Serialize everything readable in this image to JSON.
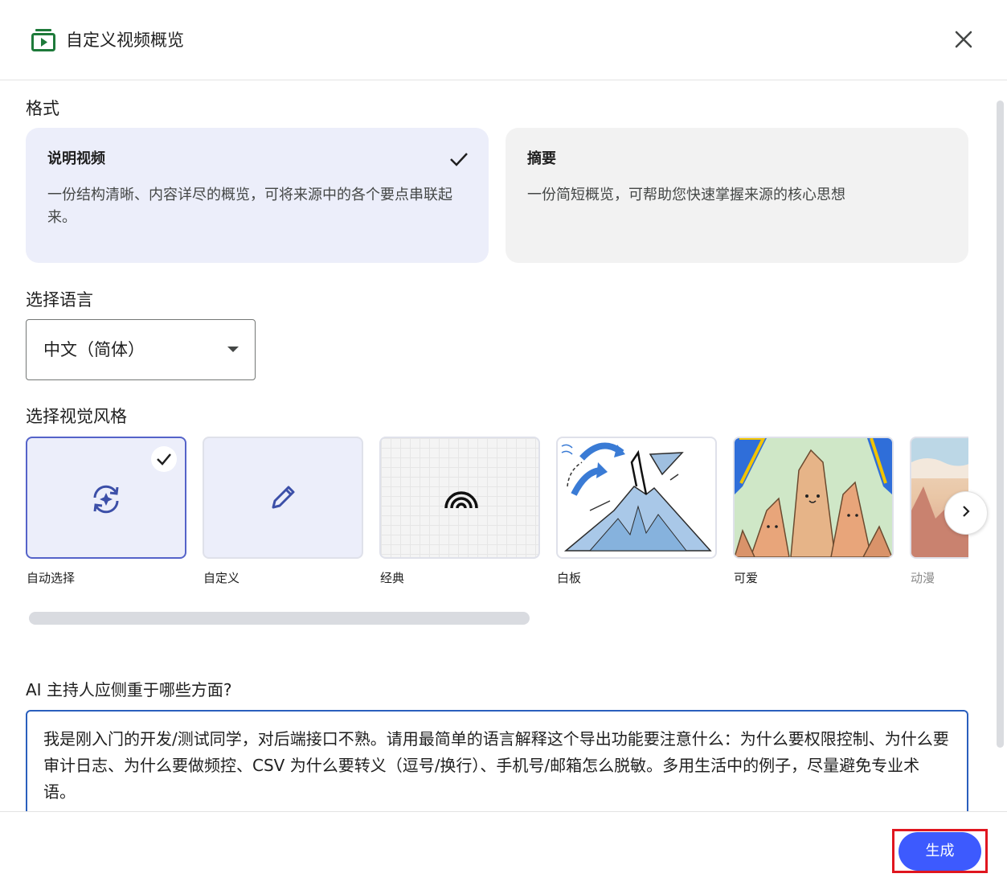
{
  "header": {
    "title": "自定义视频概览",
    "icon": "video-overview-icon"
  },
  "format": {
    "label": "格式",
    "options": [
      {
        "title": "说明视频",
        "description": "一份结构清晰、内容详尽的概览，可将来源中的各个要点串联起来。",
        "selected": true
      },
      {
        "title": "摘要",
        "description": "一份简短概览，可帮助您快速掌握来源的核心思想",
        "selected": false
      }
    ]
  },
  "language": {
    "label": "选择语言",
    "value": "中文（简体）"
  },
  "visual_style": {
    "label": "选择视觉风格",
    "items": [
      {
        "label": "自动选择",
        "selected": true
      },
      {
        "label": "自定义",
        "selected": false
      },
      {
        "label": "经典",
        "selected": false
      },
      {
        "label": "白板",
        "selected": false
      },
      {
        "label": "可爱",
        "selected": false
      },
      {
        "label": "动漫",
        "selected": false
      }
    ]
  },
  "prompt": {
    "label": "AI 主持人应侧重于哪些方面?",
    "value": "我是刚入门的开发/测试同学，对后端接口不熟。请用最简单的语言解释这个导出功能要注意什么：为什么要权限控制、为什么要审计日志、为什么要做频控、CSV 为什么要转义（逗号/换行）、手机号/邮箱怎么脱敏。多用生活中的例子，尽量避免专业术语。"
  },
  "footer": {
    "generate_label": "生成"
  },
  "colors": {
    "accent": "#3d5afe",
    "selected_bg": "#eceefa",
    "highlight": "#e0161f"
  }
}
